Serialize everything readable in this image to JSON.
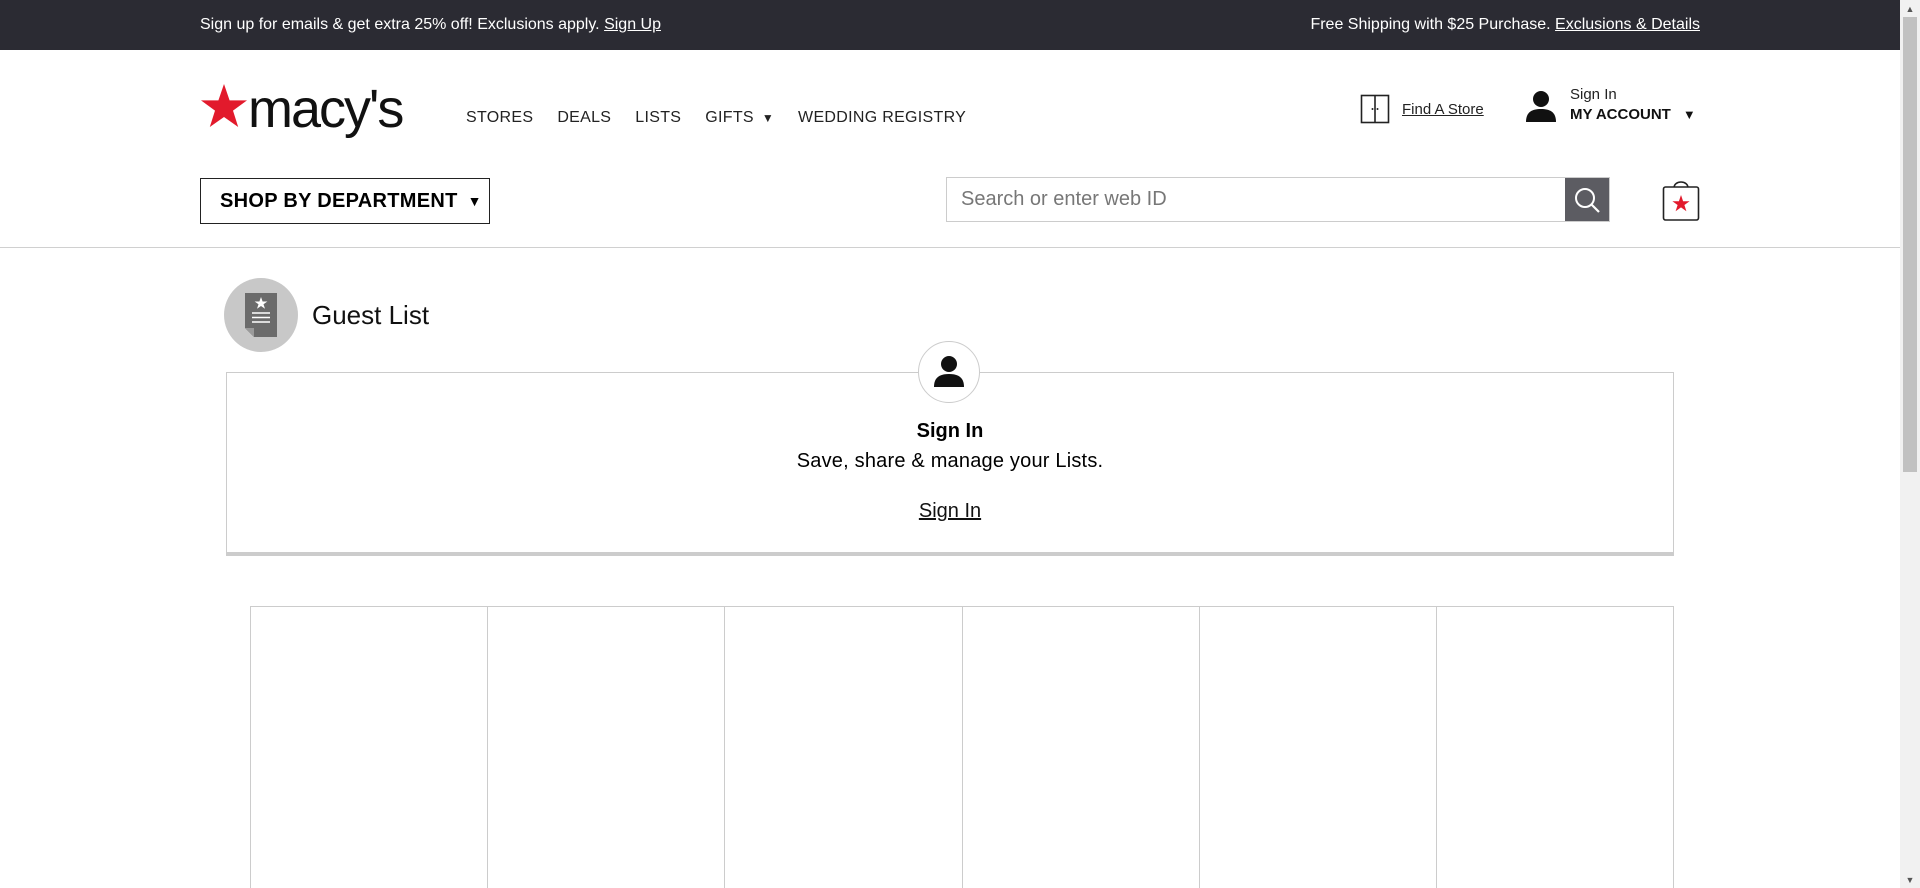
{
  "promo": {
    "left_text": "Sign up for emails & get extra 25% off! Exclusions apply.",
    "left_link": "Sign Up",
    "right_text": "Free Shipping with $25 Purchase.",
    "right_link": "Exclusions & Details"
  },
  "header": {
    "logo_text": "macy's",
    "nav": [
      {
        "label": "STORES"
      },
      {
        "label": "DEALS"
      },
      {
        "label": "LISTS"
      },
      {
        "label": "GIFTS"
      },
      {
        "label": "WEDDING REGISTRY"
      }
    ],
    "find_store": "Find A Store",
    "account_signin": "Sign In",
    "account_label": "MY ACCOUNT",
    "shop_dept": "SHOP BY DEPARTMENT",
    "search_placeholder": "Search or enter web ID"
  },
  "main": {
    "list_title": "Guest List",
    "signin_title": "Sign In",
    "signin_subtitle": "Save, share & manage your Lists.",
    "signin_link": "Sign In"
  },
  "colors": {
    "brand_red": "#e21a2c",
    "promo_bg": "#2b2b33",
    "search_button": "#5c5c62"
  }
}
